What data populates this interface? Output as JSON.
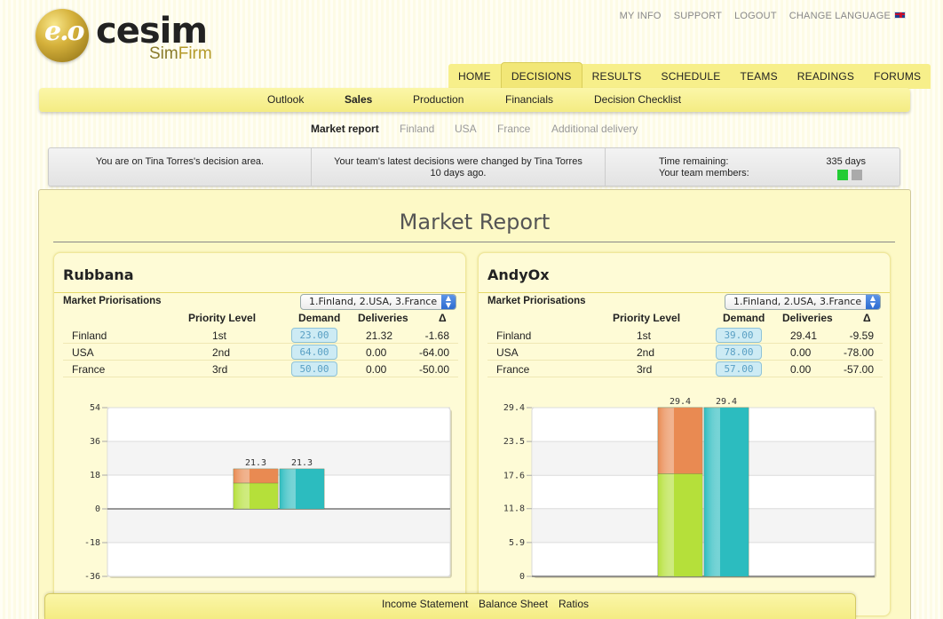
{
  "brand": {
    "logo_word": "cesim",
    "logo_sub_a": "Sim",
    "logo_sub_b": "Firm"
  },
  "top_links": [
    "MY INFO",
    "SUPPORT",
    "LOGOUT",
    "CHANGE LANGUAGE"
  ],
  "main_nav": [
    "HOME",
    "DECISIONS",
    "RESULTS",
    "SCHEDULE",
    "TEAMS",
    "READINGS",
    "FORUMS"
  ],
  "main_nav_active": "DECISIONS",
  "sub_nav": [
    "Outlook",
    "Sales",
    "Production",
    "Financials",
    "Decision Checklist"
  ],
  "sub_nav_active": "Sales",
  "tertiary_nav": [
    "Market report",
    "Finland",
    "USA",
    "France",
    "Additional delivery"
  ],
  "tertiary_nav_active": "Market report",
  "info": {
    "decision_area": "You are on Tina Torres's decision area.",
    "latest_change_1": "Your team's latest decisions were changed by Tina Torres",
    "latest_change_2": "10 days ago.",
    "time_remaining_label": "Time remaining:",
    "time_remaining_value": "335 days",
    "team_members_label": "Your team members:",
    "member_status_colors": [
      "#22cc33",
      "#aaaaaa"
    ]
  },
  "page_title": "Market Report",
  "headers": {
    "priority": "Priority Level",
    "demand": "Demand",
    "deliveries": "Deliveries",
    "delta": "Δ"
  },
  "market_label": "Market Priorisations",
  "cards": [
    {
      "title": "Rubbana",
      "priorisation": "1.Finland, 2.USA, 3.France",
      "rows": [
        {
          "market": "Finland",
          "priority": "1st",
          "demand": "23.00",
          "deliveries": "21.32",
          "delta": "-1.68"
        },
        {
          "market": "USA",
          "priority": "2nd",
          "demand": "64.00",
          "deliveries": "0.00",
          "delta": "-64.00"
        },
        {
          "market": "France",
          "priority": "3rd",
          "demand": "50.00",
          "deliveries": "0.00",
          "delta": "-50.00"
        }
      ]
    },
    {
      "title": "AndyOx",
      "priorisation": "1.Finland, 2.USA, 3.France",
      "rows": [
        {
          "market": "Finland",
          "priority": "1st",
          "demand": "39.00",
          "deliveries": "29.41",
          "delta": "-9.59"
        },
        {
          "market": "USA",
          "priority": "2nd",
          "demand": "78.00",
          "deliveries": "0.00",
          "delta": "-78.00"
        },
        {
          "market": "France",
          "priority": "3rd",
          "demand": "57.00",
          "deliveries": "0.00",
          "delta": "-57.00"
        }
      ]
    }
  ],
  "chart_data": [
    {
      "type": "bar",
      "ylim": [
        -36,
        54
      ],
      "yticks": [
        "54",
        "36",
        "18",
        "0",
        "-18",
        "-36"
      ],
      "tick_values": [
        54,
        36,
        18,
        0,
        -18,
        -36
      ],
      "bars": [
        {
          "label": "21.3",
          "total": 21.3,
          "segments": [
            {
              "value": 13.8,
              "color": "#b5e03a"
            },
            {
              "value": 7.5,
              "color": "#e98a52"
            }
          ]
        },
        {
          "label": "21.3",
          "total": 21.3,
          "segments": [
            {
              "value": 21.3,
              "color": "#2cbcbf"
            }
          ]
        }
      ]
    },
    {
      "type": "bar",
      "ylim": [
        0,
        29.4
      ],
      "yticks": [
        "29.4",
        "23.5",
        "17.6",
        "11.8",
        "5.9",
        "0"
      ],
      "tick_values": [
        29.4,
        23.5,
        17.6,
        11.8,
        5.9,
        0
      ],
      "bars": [
        {
          "label": "29.4",
          "total": 29.4,
          "segments": [
            {
              "value": 17.9,
              "color": "#b5e03a"
            },
            {
              "value": 11.5,
              "color": "#e98a52"
            }
          ]
        },
        {
          "label": "29.4",
          "total": 29.4,
          "segments": [
            {
              "value": 29.4,
              "color": "#2cbcbf"
            }
          ]
        }
      ]
    }
  ],
  "bottom_bar": [
    "Income Statement",
    "Balance Sheet",
    "Ratios"
  ]
}
